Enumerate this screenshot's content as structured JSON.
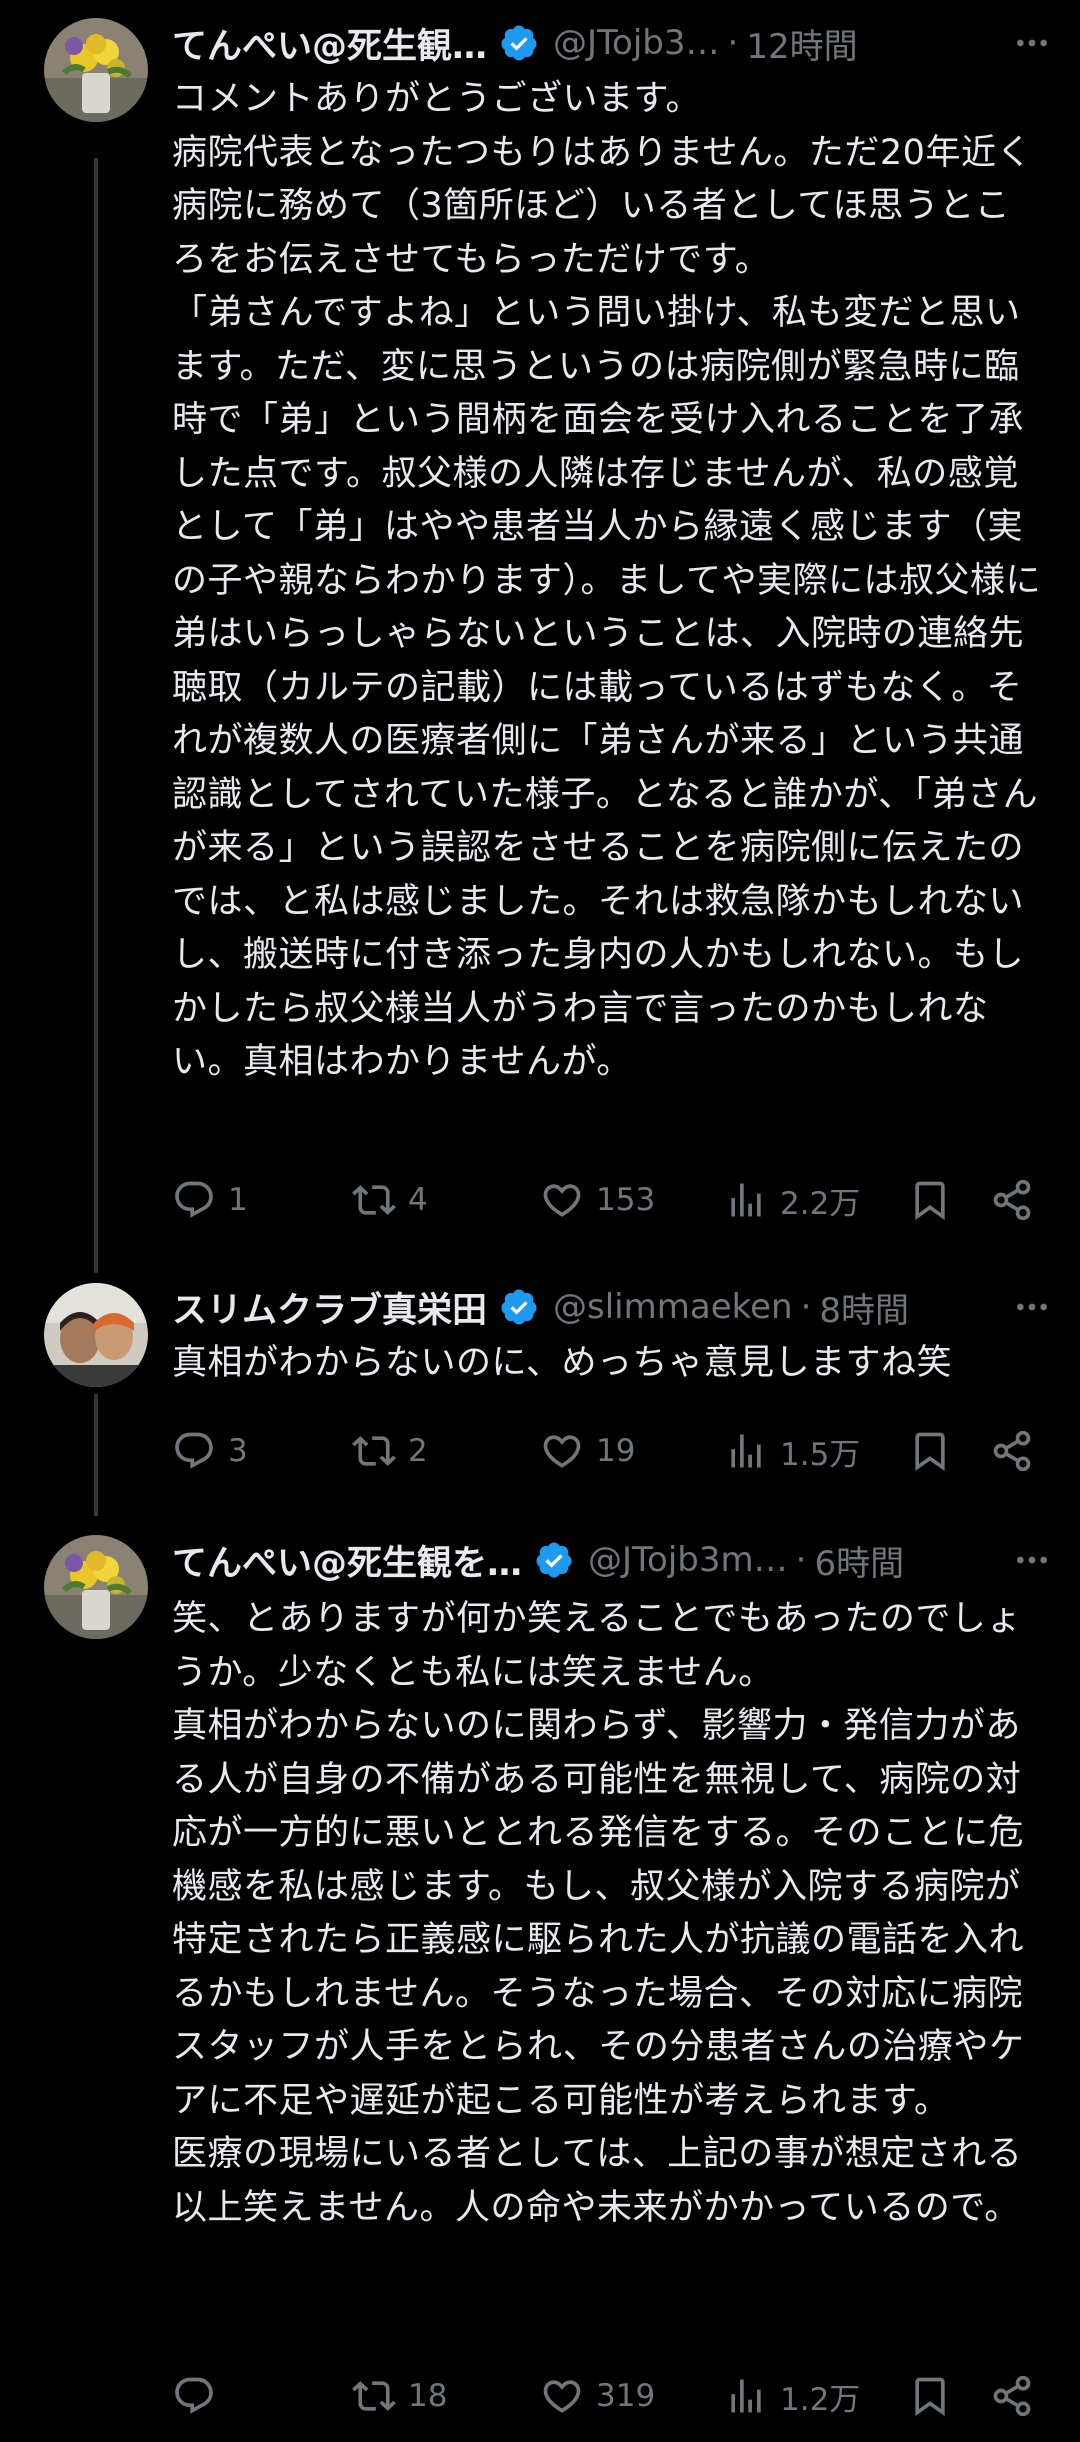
{
  "tweets": [
    {
      "name": "てんぺい@死生観…",
      "handle": "@JTojb3…",
      "time": "12時間",
      "text": "コメントありがとうございます。\n病院代表となったつもりはありません。ただ20年近く病院に務めて（3箇所ほど）いる者としてほ思うところをお伝えさせてもらっただけです。\n「弟さんですよね」という問い掛け、私も変だと思います。ただ、変に思うというのは病院側が緊急時に臨時で「弟」という間柄を面会を受け入れることを了承した点です。叔父様の人隣は存じませんが、私の感覚として「弟」はやや患者当人から縁遠く感じます（実の子や親ならわかります）。ましてや実際には叔父様に弟はいらっしゃらないということは、入院時の連絡先聴取（カルテの記載）には載っているはずもなく。それが複数人の医療者側に「弟さんが来る」という共通認識としてされていた様子。となると誰かが、「弟さんが来る」という誤認をさせることを病院側に伝えたのでは、と私は感じました。それは救急隊かもしれないし、搬送時に付き添った身内の人かもしれない。もしかしたら叔父様当人がうわ言で言ったのかもしれない。真相はわかりませんが。",
      "replies": "1",
      "retweets": "4",
      "likes": "153",
      "views": "2.2万"
    },
    {
      "name": "スリムクラブ真栄田",
      "handle": "@slimmaeken",
      "time": "8時間",
      "text": "真相がわからないのに、めっちゃ意見しますね笑",
      "replies": "3",
      "retweets": "2",
      "likes": "19",
      "views": "1.5万"
    },
    {
      "name": "てんぺい@死生観を…",
      "handle": "@JTojb3m…",
      "time": "6時間",
      "text": "笑、とありますが何か笑えることでもあったのでしょうか。少なくとも私には笑えません。\n真相がわからないのに関わらず、影響力・発信力がある人が自身の不備がある可能性を無視して、病院の対応が一方的に悪いととれる発信をする。そのことに危機感を私は感じます。もし、叔父様が入院する病院が特定されたら正義感に駆られた人が抗議の電話を入れるかもしれません。そうなった場合、その対応に病院スタッフが人手をとられ、その分患者さんの治療やケアに不足や遅延が起こる可能性が考えられます。\n医療の現場にいる者としては、上記の事が想定される以上笑えません。人の命や未来がかかっているので。",
      "replies": "",
      "retweets": "18",
      "likes": "319",
      "views": "1.2万"
    }
  ],
  "icons": [
    "verified-badge-icon",
    "more-icon",
    "reply-icon",
    "retweet-icon",
    "like-icon",
    "views-icon",
    "bookmark-icon",
    "share-icon"
  ],
  "colors": {
    "background": "#000000",
    "text": "#e7e9ea",
    "muted": "#71767b",
    "verified": "#1d9bf0",
    "thread_line": "#333639"
  }
}
